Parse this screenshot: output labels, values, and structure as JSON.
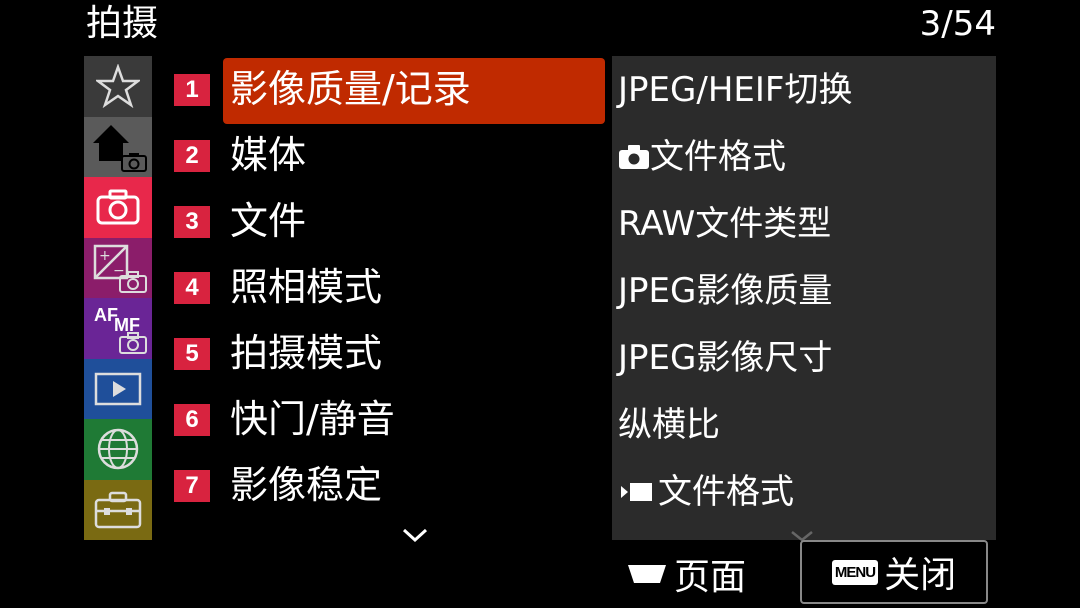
{
  "header": {
    "title": "拍摄",
    "page_indicator": "3/54"
  },
  "rail": {
    "tabs": [
      {
        "name": "favorites",
        "icon": "star-icon"
      },
      {
        "name": "main",
        "icon": "home-icon"
      },
      {
        "name": "shooting",
        "icon": "camera-icon",
        "selected": true
      },
      {
        "name": "exposure",
        "icon": "exposure-icon"
      },
      {
        "name": "focus",
        "icon": "af-mf-icon",
        "af": "AF",
        "mf": "MF"
      },
      {
        "name": "playback",
        "icon": "play-icon"
      },
      {
        "name": "network",
        "icon": "globe-icon"
      },
      {
        "name": "setup",
        "icon": "toolbox-icon"
      }
    ]
  },
  "menu": {
    "items": [
      {
        "num": "1",
        "label": "影像质量/记录",
        "selected": true
      },
      {
        "num": "2",
        "label": "媒体"
      },
      {
        "num": "3",
        "label": "文件"
      },
      {
        "num": "4",
        "label": "照相模式"
      },
      {
        "num": "5",
        "label": "拍摄模式"
      },
      {
        "num": "6",
        "label": "快门/静音"
      },
      {
        "num": "7",
        "label": "影像稳定"
      }
    ]
  },
  "submenu": {
    "items": [
      {
        "label": "JPEG/HEIF切换"
      },
      {
        "label": "文件格式",
        "prefix_icon": "camera-icon"
      },
      {
        "label": "RAW文件类型"
      },
      {
        "label": "JPEG影像质量"
      },
      {
        "label": "JPEG影像尺寸"
      },
      {
        "label": "纵横比"
      },
      {
        "label": "文件格式",
        "prefix_icon": "movie-icon"
      }
    ]
  },
  "footer": {
    "page_label": "页面",
    "menu_key": "MENU",
    "close_label": "关闭"
  }
}
